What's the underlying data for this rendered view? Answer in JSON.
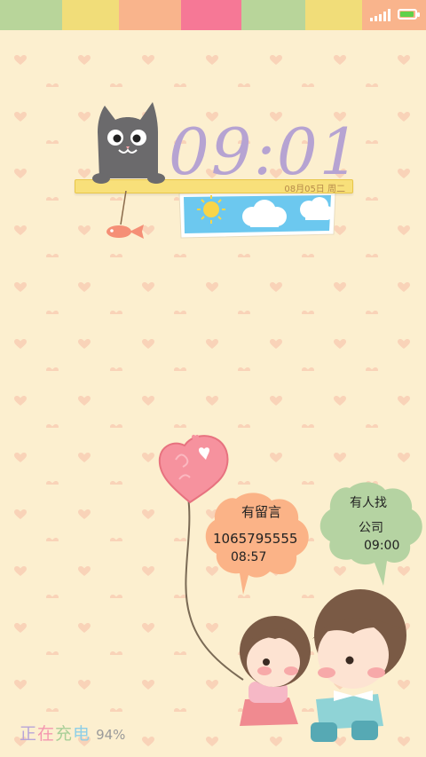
{
  "status_bar": {
    "stripe_colors": [
      "#b8d59a",
      "#f1dd79",
      "#f9b48c",
      "#f67896",
      "#b8d59a",
      "#f1dd79",
      "#f9b48c"
    ],
    "signal_icon": "signal-icon",
    "battery_icon": "battery-icon",
    "battery_color": "#5fd14a",
    "battery_level": 0.94
  },
  "clock": {
    "time": "09:01",
    "date": "08月05日 周二"
  },
  "message_bubble": {
    "title": "有留言",
    "number": "1065795555",
    "time": "08:57",
    "color": "#fbb387"
  },
  "call_bubble": {
    "title": "有人找",
    "label": "公司",
    "time": "09:00",
    "color": "#b5d3a2"
  },
  "charging": {
    "chars": [
      "正",
      "在",
      "充",
      "电"
    ],
    "char_colors": [
      "#b7a5d8",
      "#f497b0",
      "#a9cf98",
      "#8fcfe6"
    ],
    "percent": "94%"
  },
  "decorations": {
    "cat_icon": "cat-icon",
    "fish_icon": "fish-icon",
    "sky_picture": "sky-picture",
    "heart_balloon": "heart-balloon-icon",
    "couple_illustration": "couple-illustration"
  },
  "theme": {
    "background": "#fcefcf",
    "heart_pattern": "#f9d3b8",
    "clock_color": "#b6a3d2"
  }
}
